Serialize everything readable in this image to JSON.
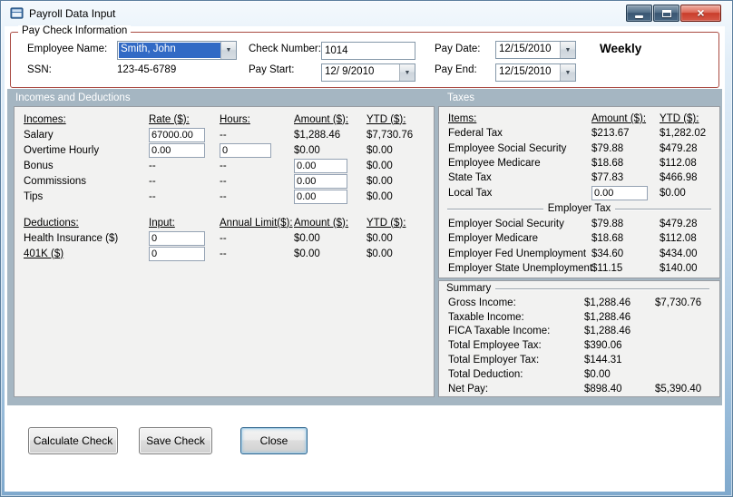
{
  "window": {
    "title": "Payroll Data Input"
  },
  "icons": {
    "dropdown": "▼",
    "close": "×"
  },
  "colors": {
    "selection": "#316ac5",
    "group_border": "#a94a42",
    "section_bg": "#a5b6c2"
  },
  "paycheck": {
    "group_title": "Pay Check Information",
    "employee_name": {
      "label": "Employee Name:",
      "value": "Smith, John"
    },
    "ssn": {
      "label": "SSN:",
      "value": "123-45-6789"
    },
    "check_number": {
      "label": "Check Number:",
      "value": "1014"
    },
    "pay_start": {
      "label": "Pay Start:",
      "value": "12/ 9/2010"
    },
    "pay_date": {
      "label": "Pay Date:",
      "value": "12/15/2010"
    },
    "pay_end": {
      "label": "Pay End:",
      "value": "12/15/2010"
    },
    "frequency": "Weekly"
  },
  "sections": {
    "left": "Incomes and Deductions",
    "right": "Taxes"
  },
  "incomes": {
    "headers": {
      "c0": "Incomes:",
      "c1": "Rate ($):",
      "c2": "Hours:",
      "c3": "Amount ($):",
      "c4": "YTD ($):"
    },
    "salary": {
      "label": "Salary",
      "rate": "67000.00",
      "hours": "--",
      "amount": "$1,288.46",
      "ytd": "$7,730.76"
    },
    "overtime": {
      "label": "Overtime Hourly",
      "rate": "0.00",
      "hours": "0",
      "amount": "$0.00",
      "ytd": "$0.00"
    },
    "bonus": {
      "label": "Bonus",
      "rate": "--",
      "hours": "--",
      "amount": "0.00",
      "ytd": "$0.00"
    },
    "commissions": {
      "label": "Commissions",
      "rate": "--",
      "hours": "--",
      "amount": "0.00",
      "ytd": "$0.00"
    },
    "tips": {
      "label": "Tips",
      "rate": "--",
      "hours": "--",
      "amount": "0.00",
      "ytd": "$0.00"
    }
  },
  "deductions": {
    "headers": {
      "c0": "Deductions:",
      "c1": "Input:",
      "c2": "Annual Limit($):",
      "c3": "Amount ($):",
      "c4": "YTD ($):"
    },
    "health": {
      "label": "Health Insurance  ($)",
      "input": "0",
      "limit": "--",
      "amount": "$0.00",
      "ytd": "$0.00"
    },
    "k401": {
      "label": "401K  ($)",
      "input": "0",
      "limit": "--",
      "amount": "$0.00",
      "ytd": "$0.00"
    }
  },
  "taxes": {
    "headers": {
      "c0": "Items:",
      "c1": "Amount ($):",
      "c2": "YTD ($):"
    },
    "federal": {
      "label": "Federal Tax",
      "amount": "$213.67",
      "ytd": "$1,282.02"
    },
    "emp_ss": {
      "label": "Employee Social Security",
      "amount": "$79.88",
      "ytd": "$479.28"
    },
    "emp_medicare": {
      "label": "Employee Medicare",
      "amount": "$18.68",
      "ytd": "$112.08"
    },
    "state": {
      "label": "State Tax",
      "amount": "$77.83",
      "ytd": "$466.98"
    },
    "local": {
      "label": "Local Tax",
      "amount": "0.00",
      "ytd": "$0.00"
    },
    "employer_group": "Employer Tax",
    "er_ss": {
      "label": "Employer Social Security",
      "amount": "$79.88",
      "ytd": "$479.28"
    },
    "er_medicare": {
      "label": "Employer Medicare",
      "amount": "$18.68",
      "ytd": "$112.08"
    },
    "er_fed_unemp": {
      "label": "Employer Fed Unemployment",
      "amount": "$34.60",
      "ytd": "$434.00"
    },
    "er_state_unemp": {
      "label": "Employer State Unemployment",
      "amount": "$11.15",
      "ytd": "$140.00"
    }
  },
  "summary": {
    "group_title": "Summary",
    "gross": {
      "label": "Gross Income:",
      "amount": "$1,288.46",
      "ytd": "$7,730.76"
    },
    "taxable": {
      "label": "Taxable Income:",
      "amount": "$1,288.46",
      "ytd": ""
    },
    "fica": {
      "label": "FICA Taxable Income:",
      "amount": "$1,288.46",
      "ytd": ""
    },
    "total_emp_tax": {
      "label": "Total Employee Tax:",
      "amount": "$390.06",
      "ytd": ""
    },
    "total_er_tax": {
      "label": "Total Employer Tax:",
      "amount": "$144.31",
      "ytd": ""
    },
    "total_deduction": {
      "label": "Total Deduction:",
      "amount": "$0.00",
      "ytd": ""
    },
    "net_pay": {
      "label": "Net Pay:",
      "amount": "$898.40",
      "ytd": "$5,390.40"
    }
  },
  "buttons": {
    "calculate": "Calculate Check",
    "save": "Save Check",
    "close": "Close"
  }
}
